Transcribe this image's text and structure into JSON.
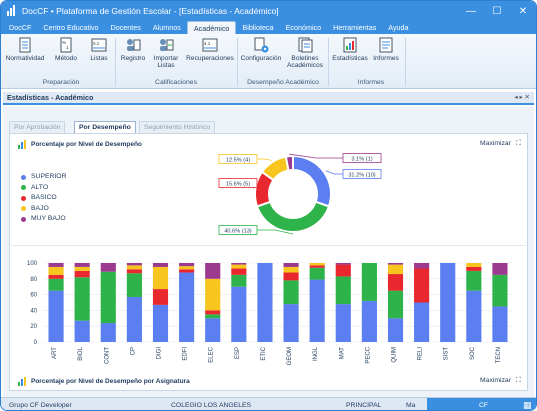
{
  "window": {
    "title": "DocCF • Plataforma de Gestión Escolar - [Estadísticas - Académico]",
    "minimize": "—",
    "maximize": "☐",
    "close": "✕"
  },
  "menu": [
    "DocCF",
    "Centro Educativo",
    "Docentes",
    "Alumnos",
    "Académico",
    "Biblioteca",
    "Económico",
    "Herramientas",
    "Ayuda"
  ],
  "ribbon": {
    "buttons": [
      {
        "label": "Normatividad",
        "icon": "document-list-icon"
      },
      {
        "label": "Método",
        "icon": "numbered-document-icon"
      },
      {
        "label": "Listas",
        "icon": "list-grid-icon"
      },
      {
        "label": "Registro",
        "icon": "users-register-icon"
      },
      {
        "label": "Importar Listas",
        "icon": "import-list-icon"
      },
      {
        "label": "Recuperaciones",
        "icon": "recovery-grades-icon"
      },
      {
        "label": "Configuración",
        "icon": "settings-document-icon"
      },
      {
        "label": "Boletines Académicos",
        "icon": "report-cards-icon"
      },
      {
        "label": "Estadísticas",
        "icon": "statistics-icon"
      },
      {
        "label": "Informes",
        "icon": "reports-icon"
      }
    ],
    "groups": [
      "Preparación",
      "Calificaciones",
      "Desempeño Académico",
      "Informes"
    ]
  },
  "doc_tab": {
    "title": "Estadísticas - Académico",
    "nav": "◂ ▸ ✕"
  },
  "sub_tabs": [
    "Por Aprobación",
    "Por Desempeño",
    "Seguimiento Histórico"
  ],
  "donut_panel": {
    "title": "Porcentaje por Nivel de Desempeño",
    "maximize": "Maximizar"
  },
  "bar_panel": {
    "title": "Porcentaje por Nivel de Desempeño por Asignatura",
    "maximize": "Maximizar"
  },
  "colors": {
    "SUPERIOR": "#5b7ff0",
    "ALTO": "#2db34a",
    "BASICO": "#e8282e",
    "BAJO": "#f7c51d",
    "MUY BAJO": "#9c3a8f"
  },
  "chart_data": [
    {
      "type": "pie",
      "title": "Porcentaje por Nivel de Desempeño",
      "categories": [
        "SUPERIOR",
        "ALTO",
        "BASICO",
        "BAJO",
        "MUY BAJO"
      ],
      "values": [
        31.2,
        40.6,
        15.6,
        12.5,
        3.1
      ],
      "labels": [
        "31.2% (10)",
        "40.6% (13)",
        "15.6% (5)",
        "12.5% (4)",
        "3.1% (1)"
      ],
      "legend": "left"
    },
    {
      "type": "bar",
      "stacked": true,
      "title": "Porcentaje por Nivel de Desempeño por Asignatura",
      "categories": [
        "ART",
        "BIOL",
        "CONT",
        "CP",
        "DIGI",
        "EDFI",
        "ELEC",
        "ESP",
        "ETIC",
        "GEOM",
        "INGL",
        "MAT",
        "PECC",
        "QUIM",
        "RELI",
        "SIST",
        "SOC",
        "TECN"
      ],
      "ylim": [
        0,
        100
      ],
      "yticks": [
        0,
        20,
        40,
        60,
        80,
        100
      ],
      "series": [
        {
          "name": "SUPERIOR",
          "values": [
            65,
            27,
            24,
            57,
            47,
            88,
            30,
            70,
            100,
            48,
            79,
            48,
            52,
            30,
            50,
            100,
            65,
            45
          ]
        },
        {
          "name": "ALTO",
          "values": [
            15,
            55,
            65,
            30,
            0,
            0,
            5,
            15,
            0,
            30,
            15,
            35,
            48,
            35,
            0,
            0,
            25,
            40
          ]
        },
        {
          "name": "BASICO",
          "values": [
            5,
            8,
            0,
            5,
            20,
            4,
            5,
            8,
            0,
            10,
            3,
            15,
            0,
            21,
            43,
            0,
            5,
            0
          ]
        },
        {
          "name": "BAJO",
          "values": [
            10,
            5,
            0,
            5,
            28,
            4,
            40,
            5,
            0,
            7,
            3,
            0,
            0,
            12,
            0,
            0,
            5,
            0
          ]
        },
        {
          "name": "MUY BAJO",
          "values": [
            5,
            5,
            11,
            3,
            5,
            4,
            20,
            2,
            0,
            5,
            0,
            2,
            0,
            2,
            7,
            0,
            0,
            15
          ]
        }
      ],
      "grid": true
    }
  ],
  "status": {
    "developer": "Grupo CF Developer",
    "school": "COLEGIO LOS ANGELES",
    "level": "PRINCIPAL",
    "shift": "Ma",
    "brand": "CF"
  }
}
